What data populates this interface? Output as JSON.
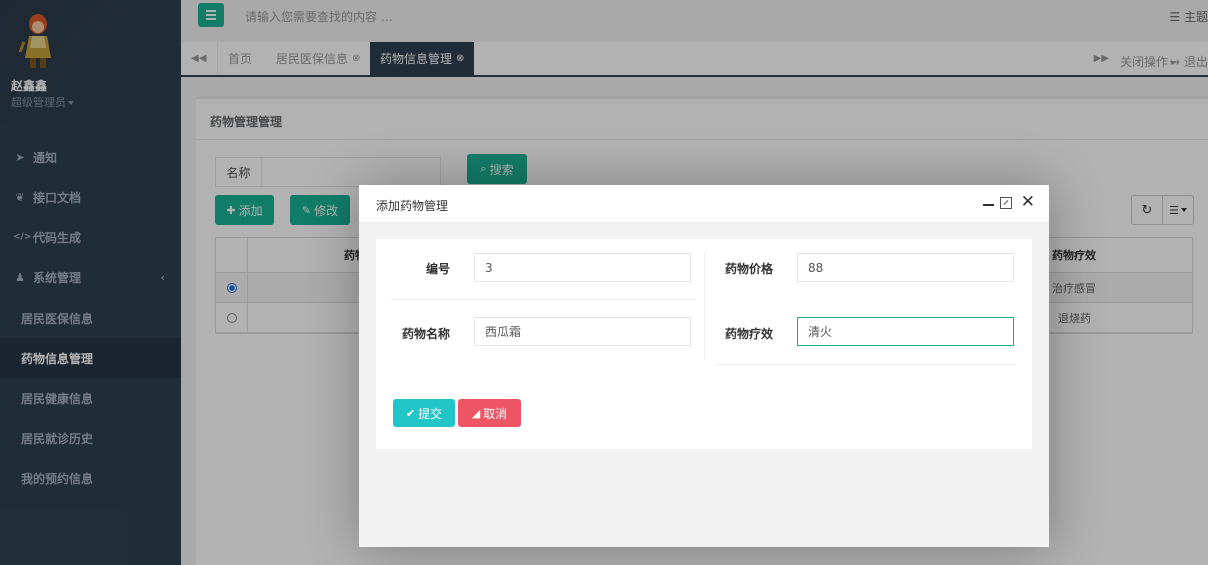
{
  "user": {
    "name": "赵鑫鑫",
    "role": "超级管理员"
  },
  "sidebar": {
    "items": [
      {
        "icon": "paper-plane-icon",
        "glyph": "➤",
        "label": "通知"
      },
      {
        "icon": "leaf-icon",
        "glyph": "❦",
        "label": "接口文档"
      },
      {
        "icon": "code-icon",
        "glyph": "</>",
        "label": "代码生成"
      },
      {
        "icon": "user-icon",
        "glyph": "♟",
        "label": "系统管理"
      }
    ],
    "sub_items": [
      {
        "label": "居民医保信息"
      },
      {
        "label": "药物信息管理"
      },
      {
        "label": "居民健康信息"
      },
      {
        "label": "居民就诊历史"
      },
      {
        "label": "我的预约信息"
      }
    ],
    "active_sub": "药物信息管理"
  },
  "topbar": {
    "search_placeholder": "请输入您需要查找的内容 …",
    "theme_label": "主题"
  },
  "tabs": {
    "items": [
      {
        "label": "首页"
      },
      {
        "label": "居民医保信息"
      },
      {
        "label": "药物信息管理"
      }
    ],
    "close_ops": "关闭操作",
    "exit_label": "退出"
  },
  "panel": {
    "title": "药物管理管理",
    "search_label": "名称",
    "search_value": "",
    "search_btn": "搜索",
    "add_btn": "添加",
    "edit_btn": "修改"
  },
  "table": {
    "columns": [
      "药物名称",
      "药物疗效"
    ],
    "rows": [
      {
        "selected": true,
        "effect": "治疗感冒"
      },
      {
        "selected": false,
        "effect": "退烧药"
      }
    ]
  },
  "modal": {
    "title": "添加药物管理",
    "fields": {
      "id_label": "编号",
      "id_value": "3",
      "price_label": "药物价格",
      "price_value": "88",
      "name_label": "药物名称",
      "name_value": "西瓜霜",
      "effect_label": "药物疗效",
      "effect_value": "清火"
    },
    "submit_btn": "提交",
    "cancel_btn": "取消"
  },
  "colors": {
    "primary": "#1ab394",
    "sidebar": "#2f4050",
    "info": "#23c6c8",
    "danger": "#ed5565"
  }
}
